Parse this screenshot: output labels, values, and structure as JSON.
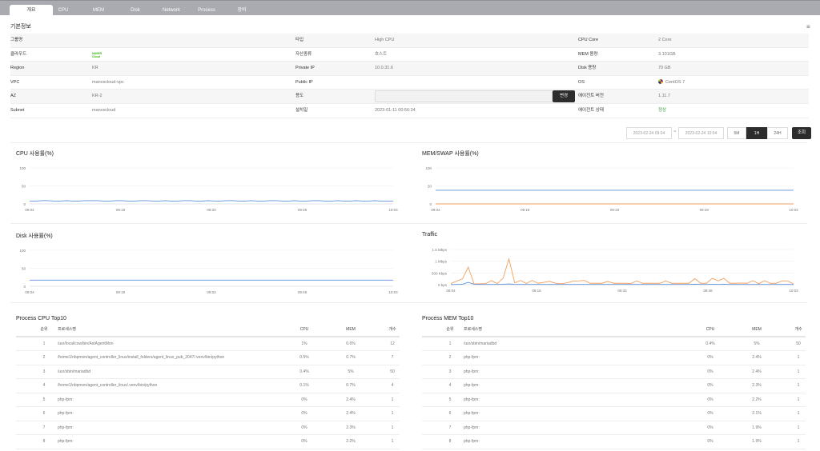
{
  "tabs": [
    {
      "label": "개요",
      "active": true
    },
    {
      "label": "CPU"
    },
    {
      "label": "MEM"
    },
    {
      "label": "Disk"
    },
    {
      "label": "Network"
    },
    {
      "label": "Process"
    },
    {
      "label": "장비"
    }
  ],
  "section_title": "기본정보",
  "info": {
    "rows": [
      [
        {
          "l": "그룹명",
          "v": ""
        },
        {
          "l": "타입",
          "v": "High CPU"
        },
        {
          "l": "CPU Core",
          "v": "2 Core"
        }
      ],
      [
        {
          "l": "클라우드",
          "v": "NAVER Cloud"
        },
        {
          "l": "자산종류",
          "v": "호스트"
        },
        {
          "l": "MEM 용량",
          "v": "3.101GB"
        }
      ],
      [
        {
          "l": "Region",
          "v": "KR"
        },
        {
          "l": "Private IP",
          "v": "10.0.31.6"
        },
        {
          "l": "Disk 용량",
          "v": "70 GB"
        }
      ],
      [
        {
          "l": "VPC",
          "v": "manvscloud-vpc"
        },
        {
          "l": "Public IP",
          "v": ""
        },
        {
          "l": "OS",
          "v": "CentOS 7"
        }
      ],
      [
        {
          "l": "AZ",
          "v": "KR-2"
        },
        {
          "l": "용도",
          "v": ""
        },
        {
          "l": "에이전트 버전",
          "v": "1.11.7"
        }
      ],
      [
        {
          "l": "Subnet",
          "v": "manvscloud"
        },
        {
          "l": "설치일",
          "v": "2023-01-11 00:56:34"
        },
        {
          "l": "에이전트 상태",
          "v": "정상"
        }
      ]
    ],
    "change_button": "변경",
    "status_color": "#3a9c3a"
  },
  "range": {
    "from": "2023-02-24 09:04",
    "sep": "~",
    "to": "2023-02-24 10:04",
    "options": [
      "5M",
      "1H",
      "24H"
    ],
    "selected": "1H",
    "search": "조회"
  },
  "chart_data": [
    {
      "type": "line",
      "title": "CPU 사용률(%)",
      "ylim": [
        0,
        100
      ],
      "yticks": [
        "0",
        "50",
        "100"
      ],
      "xticks": [
        "09:04",
        "09:18",
        "09:33",
        "09:48",
        "10:03"
      ],
      "series": [
        {
          "color": "#5b8fd9",
          "values": [
            8,
            8,
            9,
            9,
            8,
            8,
            9,
            8,
            8,
            9,
            9,
            9,
            8,
            8,
            9,
            9,
            8,
            8,
            9,
            9,
            8,
            8,
            9,
            8,
            8,
            9,
            9,
            8,
            8,
            9,
            8,
            8,
            9,
            9,
            8,
            8,
            9,
            8,
            8,
            9,
            9,
            8,
            8,
            9,
            8,
            8,
            9,
            9,
            8,
            8,
            9,
            8,
            8,
            9,
            8,
            8,
            9,
            8,
            8,
            8
          ]
        }
      ],
      "grid": true
    },
    {
      "type": "line",
      "title": "MEM/SWAP 사용률(%)",
      "ylim": [
        0,
        100
      ],
      "yticks": [
        "0",
        "50",
        "100"
      ],
      "xticks": [
        "09:04",
        "09:18",
        "09:33",
        "09:48",
        "10:03"
      ],
      "series": [
        {
          "color": "#5b8fd9",
          "values": [
            38,
            38,
            38,
            38,
            38,
            38,
            38,
            38,
            38,
            38
          ]
        },
        {
          "color": "#f0a060",
          "values": [
            0,
            0,
            0,
            0,
            0,
            0,
            0,
            0,
            0,
            0
          ]
        }
      ],
      "grid": true
    },
    {
      "type": "line",
      "title": "Disk 사용률(%)",
      "ylim": [
        0,
        100
      ],
      "yticks": [
        "0",
        "50",
        "100"
      ],
      "xticks": [
        "09:04",
        "09:18",
        "09:33",
        "09:48",
        "10:03"
      ],
      "series": [
        {
          "color": "#5b8fd9",
          "values": [
            17,
            17,
            17,
            17,
            17,
            17,
            17,
            17,
            17,
            17
          ]
        }
      ],
      "grid": true
    },
    {
      "type": "line",
      "title": "Traffic",
      "ylim": [
        0,
        1500
      ],
      "yticks": [
        "0 bps",
        "500 Kbps",
        "1 Mbps",
        "1.5 Mbps"
      ],
      "xticks": [
        "09:04",
        "09:18",
        "09:33",
        "09:48",
        "10:03"
      ],
      "series": [
        {
          "color": "#f0a060",
          "values": [
            50,
            150,
            250,
            750,
            30,
            40,
            50,
            170,
            50,
            280,
            1100,
            80,
            180,
            50,
            180,
            60,
            100,
            140,
            60,
            40,
            80,
            150,
            160,
            180,
            60,
            60,
            60,
            140,
            60,
            60,
            60,
            50,
            160,
            60,
            60,
            60,
            60,
            160,
            60,
            60,
            60,
            60,
            260,
            60,
            60,
            270,
            160,
            270,
            60,
            60,
            70,
            60,
            170,
            40,
            170,
            60,
            60,
            160,
            160,
            30
          ]
        },
        {
          "color": "#5b8fd9",
          "values": [
            5,
            10,
            20,
            100,
            20,
            10,
            10,
            10,
            10,
            20,
            30,
            10,
            10,
            10,
            10,
            10,
            10,
            10,
            10,
            10,
            10,
            10,
            10,
            10,
            10,
            10,
            10,
            10,
            10,
            10,
            10,
            10,
            10,
            10,
            10,
            10,
            10,
            10,
            10,
            10,
            10,
            10,
            20,
            10,
            10,
            20,
            10,
            20,
            10,
            10,
            10,
            10,
            10,
            10,
            10,
            10,
            10,
            10,
            10,
            5
          ]
        }
      ],
      "grid": true
    }
  ],
  "process_cpu": {
    "title": "Process CPU Top10",
    "headers": [
      "순위",
      "프로세스명",
      "CPU",
      "MEM",
      "개수"
    ],
    "rows": [
      [
        "1",
        "/usr/local/csw/bin/AstAgentMon",
        "1%",
        "0.6%",
        "12"
      ],
      [
        "2",
        "/home1/nbpmon/agent_controller_linux/install_folders/agent_linux_pub_2047/.venv/bin/python",
        "0.5%",
        "0.7%",
        "7"
      ],
      [
        "3",
        "/usr/sbin/mariadbd",
        "0.4%",
        "5%",
        "50"
      ],
      [
        "4",
        "/home1/nbpmon/agent_controller_linux/.venv/bin/python",
        "0.1%",
        "0.7%",
        "4"
      ],
      [
        "5",
        "php-fpm:",
        "0%",
        "2.4%",
        "1"
      ],
      [
        "6",
        "php-fpm:",
        "0%",
        "2.4%",
        "1"
      ],
      [
        "7",
        "php-fpm:",
        "0%",
        "2.3%",
        "1"
      ],
      [
        "8",
        "php-fpm:",
        "0%",
        "2.2%",
        "1"
      ]
    ]
  },
  "process_mem": {
    "title": "Process MEM Top10",
    "headers": [
      "순위",
      "프로세스명",
      "CPU",
      "MEM",
      "개수"
    ],
    "rows": [
      [
        "1",
        "/usr/sbin/mariadbd",
        "0.4%",
        "5%",
        "50"
      ],
      [
        "2",
        "php-fpm:",
        "0%",
        "2.4%",
        "1"
      ],
      [
        "3",
        "php-fpm:",
        "0%",
        "2.4%",
        "1"
      ],
      [
        "4",
        "php-fpm:",
        "0%",
        "2.3%",
        "1"
      ],
      [
        "5",
        "php-fpm:",
        "0%",
        "2.2%",
        "1"
      ],
      [
        "6",
        "php-fpm:",
        "0%",
        "2.1%",
        "1"
      ],
      [
        "7",
        "php-fpm:",
        "0%",
        "1.9%",
        "1"
      ],
      [
        "8",
        "php-fpm:",
        "0%",
        "1.9%",
        "1"
      ]
    ]
  }
}
